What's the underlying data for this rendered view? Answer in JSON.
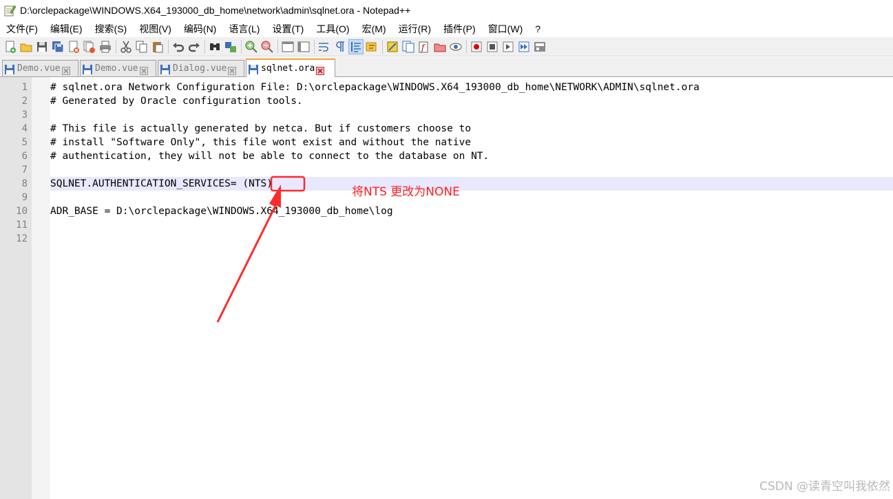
{
  "window": {
    "title": "D:\\orclepackage\\WINDOWS.X64_193000_db_home\\network\\admin\\sqlnet.ora - Notepad++"
  },
  "menu": [
    {
      "label": "文件(F)"
    },
    {
      "label": "编辑(E)"
    },
    {
      "label": "搜索(S)"
    },
    {
      "label": "视图(V)"
    },
    {
      "label": "编码(N)"
    },
    {
      "label": "语言(L)"
    },
    {
      "label": "设置(T)"
    },
    {
      "label": "工具(O)"
    },
    {
      "label": "宏(M)"
    },
    {
      "label": "运行(R)"
    },
    {
      "label": "插件(P)"
    },
    {
      "label": "窗口(W)"
    },
    {
      "label": "?"
    }
  ],
  "tabs": [
    {
      "label": "Demo.vue",
      "active": false
    },
    {
      "label": "Demo.vue",
      "active": false
    },
    {
      "label": "Dialog.vue",
      "active": false
    },
    {
      "label": "sqlnet.ora",
      "active": true
    }
  ],
  "editor": {
    "line_numbers": [
      "1",
      "2",
      "3",
      "4",
      "5",
      "6",
      "7",
      "8",
      "9",
      "10",
      "11",
      "12"
    ],
    "current_line": 8,
    "lines": [
      "# sqlnet.ora Network Configuration File: D:\\orclepackage\\WINDOWS.X64_193000_db_home\\NETWORK\\ADMIN\\sqlnet.ora",
      "# Generated by Oracle configuration tools.",
      "",
      "# This file is actually generated by netca. But if customers choose to",
      "# install \"Software Only\", this file wont exist and without the native",
      "# authentication, they will not be able to connect to the database on NT.",
      "",
      "SQLNET.AUTHENTICATION_SERVICES= ",
      "",
      "ADR_BASE = D:\\orclepackage\\WINDOWS.X64_193000_db_home\\log",
      "",
      ""
    ],
    "line8_value": "(NTS)"
  },
  "annotation": {
    "text": "将NTS 更改为NONE",
    "color": "#ff2020"
  },
  "watermark": "CSDN @读青空叫我依然"
}
